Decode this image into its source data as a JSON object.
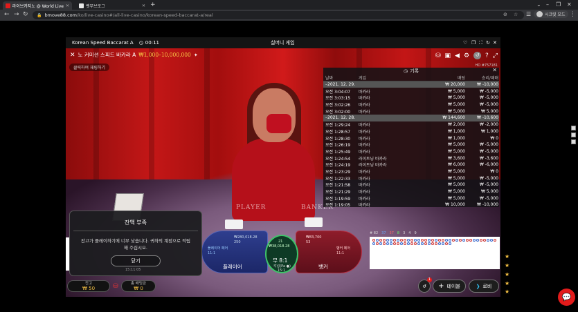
{
  "browser": {
    "tabs": [
      {
        "title": "라이브카지노 @ World Live | Bo",
        "active": true
      },
      {
        "title": "벳무브로그",
        "active": false
      }
    ],
    "url_host": "bmove88.com",
    "url_path": "/ko/live-casino#/all-live-casino/korean-speed-baccarat-a/real",
    "profile_label": "시크릿 모드"
  },
  "game": {
    "table_name": "Korean Speed Baccarat A",
    "timer": "00:11",
    "mode_title": "실머니 게임",
    "subtitle_name": "노 커미션 스피드 바카라 A",
    "limits": "₩1,000–10,000,000",
    "tap_hint": "클릭하여 재링하기",
    "hd_label": "HD #757181"
  },
  "history": {
    "title": "기록",
    "columns": [
      "날짜",
      "게임",
      "배팅",
      "승리/패배"
    ],
    "groups": [
      {
        "date": "2021. 12. 29.",
        "bet_total": "₩ 20,000",
        "result_total": "₩ -10,000",
        "rows": [
          {
            "time": "오전 3:04:07",
            "game": "바카라",
            "bet": "₩ 5,000",
            "result": "₩ -5,000"
          },
          {
            "time": "오전 3:03:15",
            "game": "바카라",
            "bet": "₩ 5,000",
            "result": "₩ -5,000"
          },
          {
            "time": "오전 3:02:26",
            "game": "바카라",
            "bet": "₩ 5,000",
            "result": "₩ -5,000"
          },
          {
            "time": "오전 3:02:00",
            "game": "바카라",
            "bet": "₩ 5,000",
            "result": "₩ 5,000"
          }
        ]
      },
      {
        "date": "2021. 12. 28.",
        "bet_total": "₩ 144,600",
        "result_total": "₩ -10,600",
        "rows": [
          {
            "time": "오전 1:29:24",
            "game": "바카라",
            "bet": "₩ 2,000",
            "result": "₩ -2,000"
          },
          {
            "time": "오전 1:28:57",
            "game": "바카라",
            "bet": "₩ 1,000",
            "result": "₩ 1,000"
          },
          {
            "time": "오전 1:28:30",
            "game": "바카라",
            "bet": "₩ 1,000",
            "result": "₩ 0"
          },
          {
            "time": "오전 1:26:19",
            "game": "바카라",
            "bet": "₩ 5,000",
            "result": "₩ -5,000"
          },
          {
            "time": "오전 1:25:49",
            "game": "바카라",
            "bet": "₩ 5,000",
            "result": "₩ -5,000"
          },
          {
            "time": "오전 1:24:54",
            "game": "라이트닝 바카라",
            "bet": "₩ 3,600",
            "result": "₩ -3,600"
          },
          {
            "time": "오전 1:24:19",
            "game": "라이트닝 바카라",
            "bet": "₩ 6,000",
            "result": "₩ -6,000"
          },
          {
            "time": "오전 1:23:29",
            "game": "바카라",
            "bet": "₩ 5,000",
            "result": "₩ 0"
          },
          {
            "time": "오전 1:22:33",
            "game": "바카라",
            "bet": "₩ 5,000",
            "result": "₩ -5,000"
          },
          {
            "time": "오전 1:21:58",
            "game": "바카라",
            "bet": "₩ 5,000",
            "result": "₩ -5,000"
          },
          {
            "time": "오전 1:21:29",
            "game": "바카라",
            "bet": "₩ 5,000",
            "result": "₩ 5,000"
          },
          {
            "time": "오전 1:19:59",
            "game": "바카라",
            "bet": "₩ 5,000",
            "result": "₩ -5,000"
          },
          {
            "time": "오전 1:19:05",
            "game": "바카라",
            "bet": "₩ 10,000",
            "result": "₩ -10,000"
          }
        ]
      }
    ]
  },
  "bets": {
    "player_label": "플레이어",
    "banker_label": "뱅커",
    "tie_label": "무 8:1",
    "player_pair": "플레이어 페어 11:1",
    "banker_pair": "뱅커 페어 11:1",
    "player_amount": "₩280,018.28",
    "banker_amount": "₩83,700",
    "tie_amount": "₩38,018.28",
    "player_count": "250",
    "banker_count": "53",
    "tie_count": "21",
    "bonus_label": "각성(Pa ●)",
    "bonus_odds": "15:1"
  },
  "roadmap_stats": [
    "# 82",
    "37",
    "37",
    "8",
    "3",
    "4",
    "9"
  ],
  "modal": {
    "title": "잔액 부족",
    "body": "잔고가 플레이하기에 너무 낮습니다. 귀하의 계정으로 적립해 주십시오.",
    "button": "닫기",
    "timestamp": "15:11:05"
  },
  "bottom": {
    "balance_label": "잔고",
    "balance_value": "₩ 50",
    "total_bet_label": "총 배팅금",
    "total_bet_value": "₩ 0",
    "tables_button": "테이블",
    "lobby_button": "로비",
    "notif_badge": "1"
  },
  "felt": {
    "player_text": "PLAYER",
    "banker_text": "BANKER"
  },
  "colors": {
    "accent": "#f6c244",
    "player": "#2e3e8e",
    "banker": "#8e1c2a",
    "tie": "#3fc46a",
    "chat": "#e21b1b"
  }
}
